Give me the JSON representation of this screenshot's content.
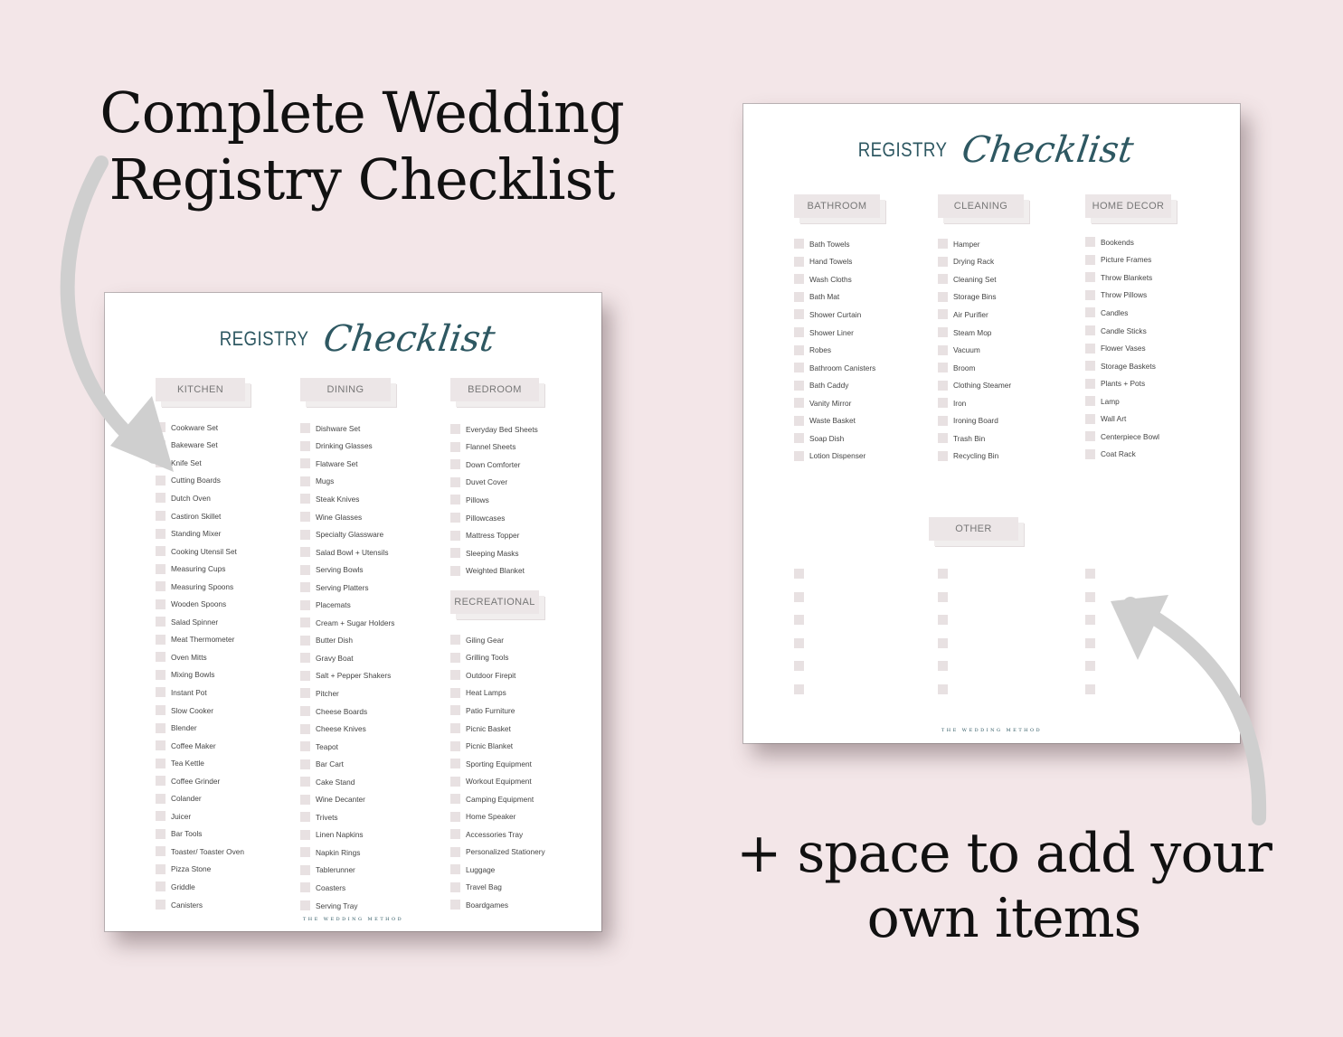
{
  "headline_top": {
    "line1": "Complete Wedding",
    "line2": "Registry Checklist"
  },
  "headline_bottom": {
    "line1": "+ space to add your",
    "line2": "own items"
  },
  "colors": {
    "background": "#f3e6e8",
    "title_teal": "#2e5862",
    "tab_fill": "#ece6e7",
    "checkbox": "#e8e1e2",
    "arrow": "#cfcfcf"
  },
  "sheet_title": {
    "caps": "REGISTRY",
    "script": "Checklist"
  },
  "footer_text": "THE WEDDING METHOD",
  "left_sheet": {
    "kitchen": {
      "label": "KITCHEN",
      "items": [
        "Cookware Set",
        "Bakeware Set",
        "Knife Set",
        "Cutting Boards",
        "Dutch Oven",
        "Castiron Skillet",
        "Standing Mixer",
        "Cooking Utensil Set",
        "Measuring Cups",
        "Measuring Spoons",
        "Wooden Spoons",
        "Salad Spinner",
        "Meat Thermometer",
        "Oven Mitts",
        "Mixing Bowls",
        "Instant Pot",
        "Slow Cooker",
        "Blender",
        "Coffee Maker",
        "Tea Kettle",
        "Coffee Grinder",
        "Colander",
        "Juicer",
        "Bar Tools",
        "Toaster/ Toaster Oven",
        "Pizza Stone",
        "Griddle",
        "Canisters"
      ]
    },
    "dining": {
      "label": "DINING",
      "items": [
        "Dishware Set",
        "Drinking Glasses",
        "Flatware Set",
        "Mugs",
        "Steak Knives",
        "Wine Glasses",
        "Specialty Glassware",
        "Salad Bowl + Utensils",
        "Serving Bowls",
        "Serving Platters",
        "Placemats",
        "Cream + Sugar Holders",
        "Butter Dish",
        "Gravy Boat",
        "Salt + Pepper Shakers",
        "Pitcher",
        "Cheese Boards",
        "Cheese Knives",
        "Teapot",
        "Bar Cart",
        "Cake Stand",
        "Wine Decanter",
        "Trivets",
        "Linen Napkins",
        "Napkin Rings",
        "Tablerunner",
        "Coasters",
        "Serving Tray"
      ]
    },
    "bedroom": {
      "label": "BEDROOM",
      "items": [
        "Everyday Bed Sheets",
        "Flannel Sheets",
        "Down Comforter",
        "Duvet Cover",
        "Pillows",
        "Pillowcases",
        "Mattress Topper",
        "Sleeping Masks",
        "Weighted Blanket"
      ]
    },
    "recreational": {
      "label": "RECREATIONAL",
      "items": [
        "Giling Gear",
        "Grilling Tools",
        "Outdoor Firepit",
        "Heat Lamps",
        "Patio Furniture",
        "Picnic Basket",
        "Picnic Blanket",
        "Sporting Equipment",
        "Workout Equipment",
        "Camping Equipment",
        "Home Speaker",
        "Accessories Tray",
        "Personalized Stationery",
        "Luggage",
        "Travel Bag",
        "Boardgames"
      ]
    }
  },
  "right_sheet": {
    "bathroom": {
      "label": "BATHROOM",
      "items": [
        "Bath Towels",
        "Hand Towels",
        "Wash Cloths",
        "Bath Mat",
        "Shower Curtain",
        "Shower Liner",
        "Robes",
        "Bathroom Canisters",
        "Bath Caddy",
        "Vanity Mirror",
        "Waste Basket",
        "Soap Dish",
        "Lotion Dispenser"
      ]
    },
    "cleaning": {
      "label": "CLEANING",
      "items": [
        "Hamper",
        "Drying Rack",
        "Cleaning Set",
        "Storage Bins",
        "Air Purifier",
        "Steam Mop",
        "Vacuum",
        "Broom",
        "Clothing Steamer",
        "Iron",
        "Ironing Board",
        "Trash Bin",
        "Recycling Bin"
      ]
    },
    "home_decor": {
      "label": "HOME DECOR",
      "items": [
        "Bookends",
        "Picture Frames",
        "Throw Blankets",
        "Throw Pillows",
        "Candles",
        "Candle Sticks",
        "Flower Vases",
        "Storage Baskets",
        "Plants + Pots",
        "Lamp",
        "Wall Art",
        "Centerpiece Bowl",
        "Coat Rack"
      ]
    },
    "other": {
      "label": "OTHER",
      "blank_rows_per_column": 6,
      "columns": 3
    }
  }
}
